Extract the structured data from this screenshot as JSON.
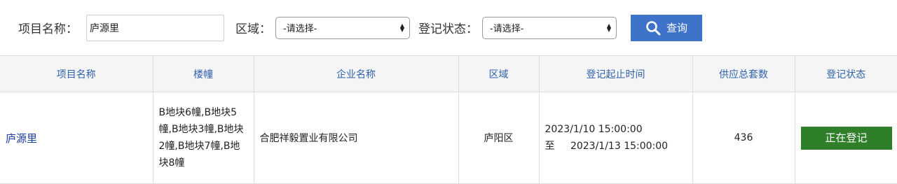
{
  "search": {
    "project_label": "项目名称：",
    "project_value": "庐源里",
    "region_label": "区域：",
    "region_selected": "-请选择-",
    "status_label": "登记状态：",
    "status_selected": "-请选择-",
    "query_label": "查询",
    "query_icon": "search-icon"
  },
  "table": {
    "headers": [
      "项目名称",
      "楼幢",
      "企业名称",
      "区域",
      "登记起止时间",
      "供应总套数",
      "登记状态"
    ],
    "rows": [
      {
        "project": "庐源里",
        "buildings": "B地块6幢,B地块5幢,B地块3幢,B地块2幢,B地块7幢,B地块8幢",
        "company": "合肥祥毅置业有限公司",
        "region": "庐阳区",
        "start": "2023/1/10 15:00:00",
        "to_label": "至",
        "end": "2023/1/13 15:00:00",
        "units": "436",
        "status": "正在登记"
      }
    ]
  },
  "colors": {
    "header_text": "#2f62ad",
    "link": "#1a3ea8",
    "button": "#3f73c9",
    "status_badge": "#2f7f2a"
  }
}
